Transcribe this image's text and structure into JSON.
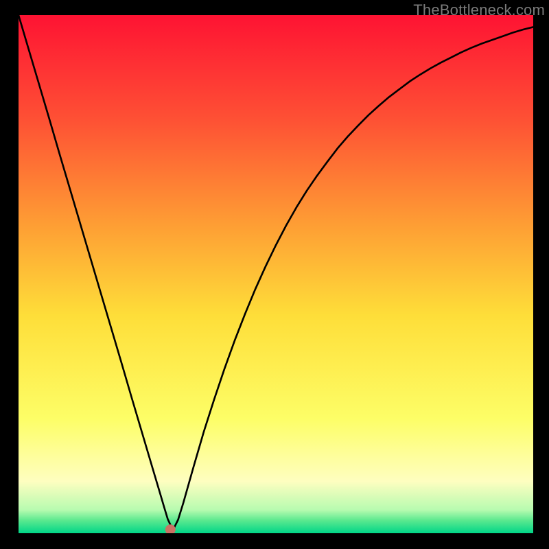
{
  "watermark": {
    "text": "TheBottleneck.com"
  },
  "chart_data": {
    "type": "line",
    "title": "",
    "xlabel": "",
    "ylabel": "",
    "xlim": [
      0,
      1
    ],
    "ylim": [
      0,
      1
    ],
    "grid": false,
    "legend": false,
    "background": {
      "type": "vertical-gradient",
      "stops": [
        {
          "pos": 0.0,
          "color": "#fe1333"
        },
        {
          "pos": 0.2,
          "color": "#fe5034"
        },
        {
          "pos": 0.4,
          "color": "#fe9c34"
        },
        {
          "pos": 0.58,
          "color": "#fede39"
        },
        {
          "pos": 0.78,
          "color": "#fdfe67"
        },
        {
          "pos": 0.9,
          "color": "#fefec0"
        },
        {
          "pos": 0.955,
          "color": "#b7fbb0"
        },
        {
          "pos": 0.975,
          "color": "#5ce98f"
        },
        {
          "pos": 1.0,
          "color": "#00d688"
        }
      ]
    },
    "marker": {
      "x": 0.295,
      "y": 0.007,
      "color": "#c97364",
      "radius_frac": 0.01
    },
    "annotations": [],
    "series": [
      {
        "name": "bottleneck-curve",
        "color": "#000000",
        "width_frac": 0.0035,
        "x": [
          0.0,
          0.02,
          0.04,
          0.06,
          0.08,
          0.1,
          0.12,
          0.14,
          0.16,
          0.18,
          0.2,
          0.22,
          0.24,
          0.26,
          0.275,
          0.283,
          0.29,
          0.3,
          0.31,
          0.32,
          0.34,
          0.36,
          0.38,
          0.4,
          0.42,
          0.44,
          0.46,
          0.48,
          0.5,
          0.52,
          0.54,
          0.56,
          0.58,
          0.6,
          0.62,
          0.64,
          0.66,
          0.68,
          0.7,
          0.72,
          0.74,
          0.76,
          0.78,
          0.8,
          0.82,
          0.84,
          0.86,
          0.88,
          0.9,
          0.92,
          0.94,
          0.96,
          0.98,
          1.0
        ],
        "y": [
          1.0,
          0.933,
          0.866,
          0.799,
          0.731,
          0.664,
          0.597,
          0.53,
          0.463,
          0.396,
          0.329,
          0.261,
          0.194,
          0.127,
          0.077,
          0.05,
          0.027,
          0.006,
          0.026,
          0.058,
          0.128,
          0.196,
          0.258,
          0.317,
          0.372,
          0.423,
          0.471,
          0.515,
          0.556,
          0.594,
          0.629,
          0.661,
          0.69,
          0.717,
          0.743,
          0.766,
          0.787,
          0.807,
          0.825,
          0.842,
          0.857,
          0.872,
          0.885,
          0.897,
          0.908,
          0.918,
          0.928,
          0.937,
          0.945,
          0.952,
          0.959,
          0.966,
          0.972,
          0.977
        ]
      }
    ]
  }
}
